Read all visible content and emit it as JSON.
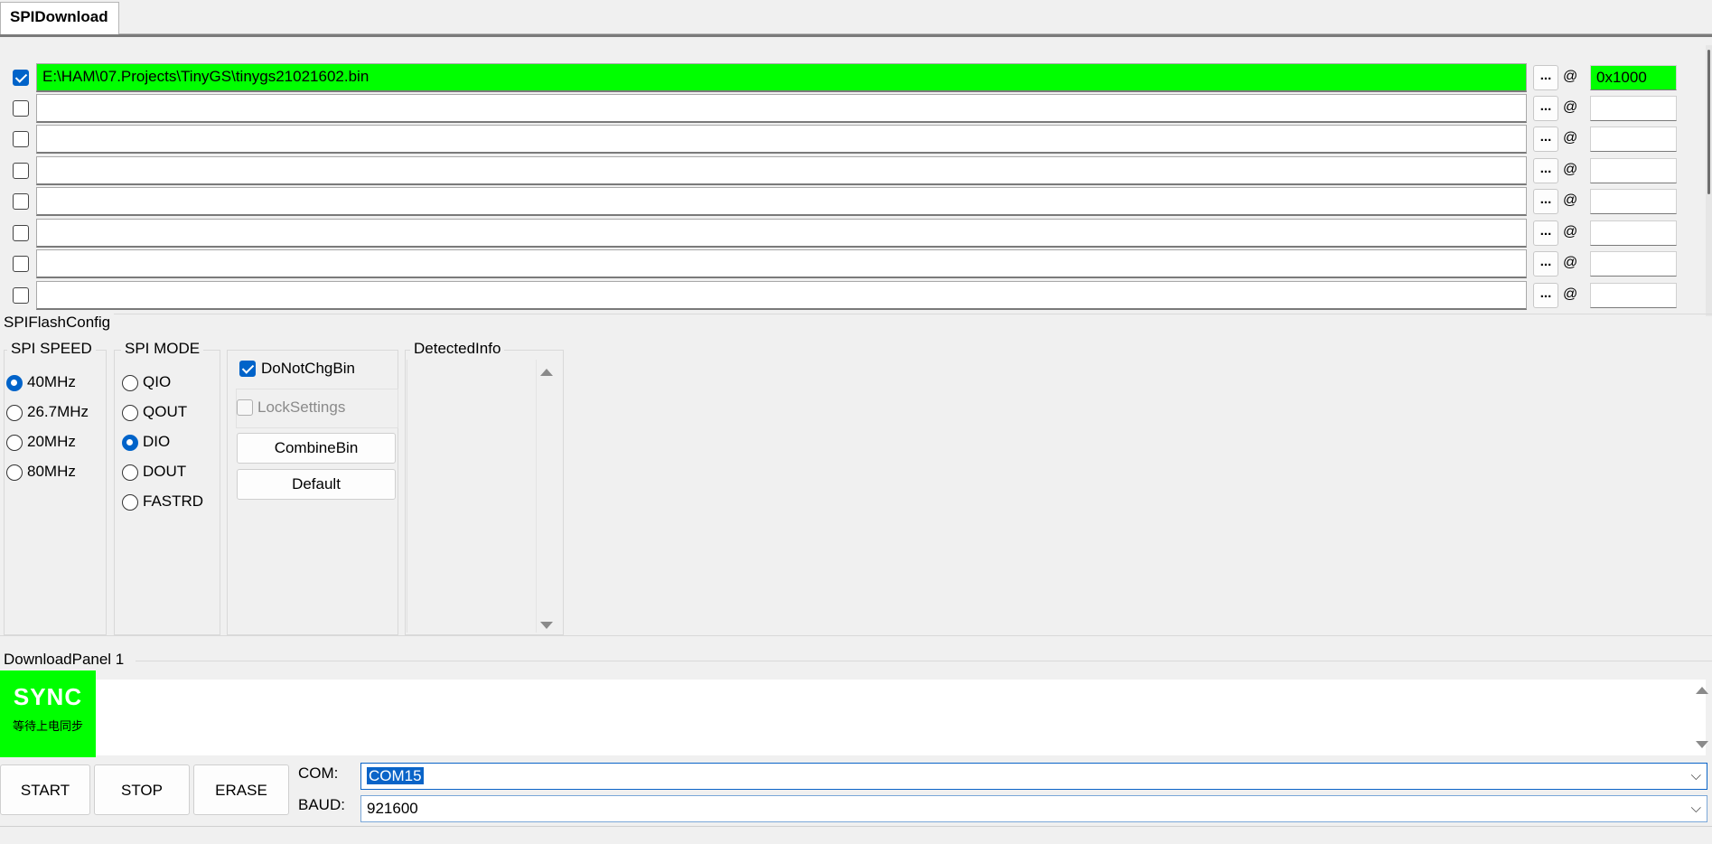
{
  "tab": {
    "label": "SPIDownload"
  },
  "files": [
    {
      "checked": true,
      "path": "E:\\HAM\\07.Projects\\TinyGS\\tinygs21021602.bin",
      "address": "0x1000",
      "highlight": true
    },
    {
      "checked": false,
      "path": "",
      "address": "",
      "highlight": false
    },
    {
      "checked": false,
      "path": "",
      "address": "",
      "highlight": false
    },
    {
      "checked": false,
      "path": "",
      "address": "",
      "highlight": false
    },
    {
      "checked": false,
      "path": "",
      "address": "",
      "highlight": false
    },
    {
      "checked": false,
      "path": "",
      "address": "",
      "highlight": false
    },
    {
      "checked": false,
      "path": "",
      "address": "",
      "highlight": false
    },
    {
      "checked": false,
      "path": "",
      "address": "",
      "highlight": false
    }
  ],
  "browse_label": "...",
  "at_label": "@",
  "spi_flash_config": {
    "title": "SPIFlashConfig",
    "speed": {
      "title": "SPI SPEED",
      "options": [
        "40MHz",
        "26.7MHz",
        "20MHz",
        "80MHz"
      ],
      "selected": 0
    },
    "mode": {
      "title": "SPI MODE",
      "options": [
        "QIO",
        "QOUT",
        "DIO",
        "DOUT",
        "FASTRD"
      ],
      "selected": 2
    },
    "do_not_chg_bin": {
      "label": "DoNotChgBin",
      "checked": true
    },
    "lock_settings": {
      "label": "LockSettings",
      "checked": false
    },
    "combine_bin_label": "CombineBin",
    "default_label": "Default",
    "detected_info_title": "DetectedInfo"
  },
  "download_panel": {
    "title": "DownloadPanel 1",
    "status": "SYNC",
    "status_sub": "等待上电同步",
    "start_label": "START",
    "stop_label": "STOP",
    "erase_label": "ERASE",
    "com_label": "COM:",
    "com_value": "COM15",
    "baud_label": "BAUD:",
    "baud_value": "921600"
  },
  "colors": {
    "highlight": "#00ff00",
    "accent": "#0063c9"
  },
  "icons": {
    "dropdown": "chevron-down-icon",
    "check": "checkmark-icon"
  }
}
